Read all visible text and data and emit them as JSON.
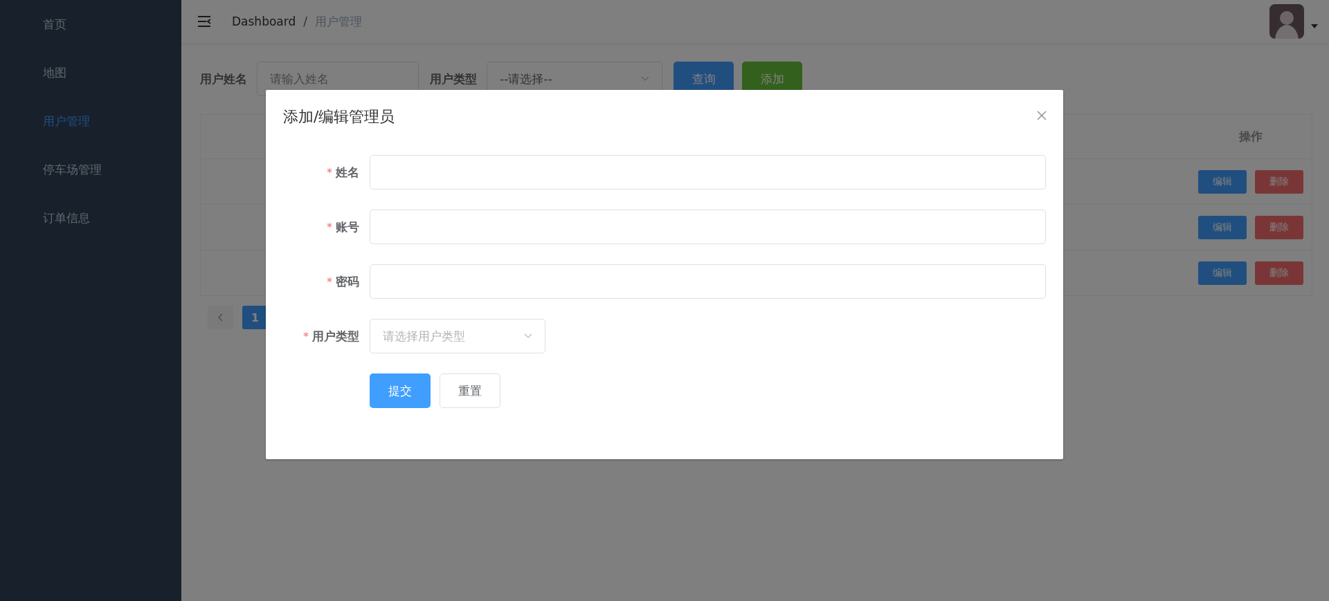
{
  "sidebar": {
    "items": [
      {
        "label": "首页",
        "selected": false
      },
      {
        "label": "地图",
        "selected": false
      },
      {
        "label": "用户管理",
        "selected": true
      },
      {
        "label": "停车场管理",
        "selected": false
      },
      {
        "label": "订单信息",
        "selected": false
      }
    ]
  },
  "header": {
    "breadcrumb": [
      "Dashboard",
      "用户管理"
    ],
    "separator": "/"
  },
  "search": {
    "name_label": "用户姓名",
    "name_placeholder": "请输入姓名",
    "type_label": "用户类型",
    "type_placeholder": "--请选择--",
    "buttons": [
      {
        "label": "查询",
        "kind": "primary"
      },
      {
        "label": "添加",
        "kind": "success"
      }
    ]
  },
  "table": {
    "columns": [
      "操作"
    ],
    "rows": [
      {
        "actions": [
          "编辑",
          "删除"
        ]
      },
      {
        "actions": [
          "编辑",
          "删除"
        ]
      },
      {
        "actions": [
          "编辑",
          "删除"
        ]
      }
    ]
  },
  "pagination": {
    "pages": [
      {
        "label": "1",
        "selected": true
      }
    ]
  },
  "dialog": {
    "title": "添加/编辑管理员",
    "required_mark": "*",
    "fields": [
      {
        "label": "姓名",
        "kind": "input",
        "required": true
      },
      {
        "label": "账号",
        "kind": "input",
        "required": true
      },
      {
        "label": "密码",
        "kind": "input",
        "required": true
      },
      {
        "label": "用户类型",
        "kind": "select",
        "required": true,
        "placeholder": "请选择用户类型"
      }
    ],
    "buttons": [
      {
        "label": "提交",
        "kind": "primary"
      },
      {
        "label": "重置",
        "kind": "default"
      }
    ]
  }
}
